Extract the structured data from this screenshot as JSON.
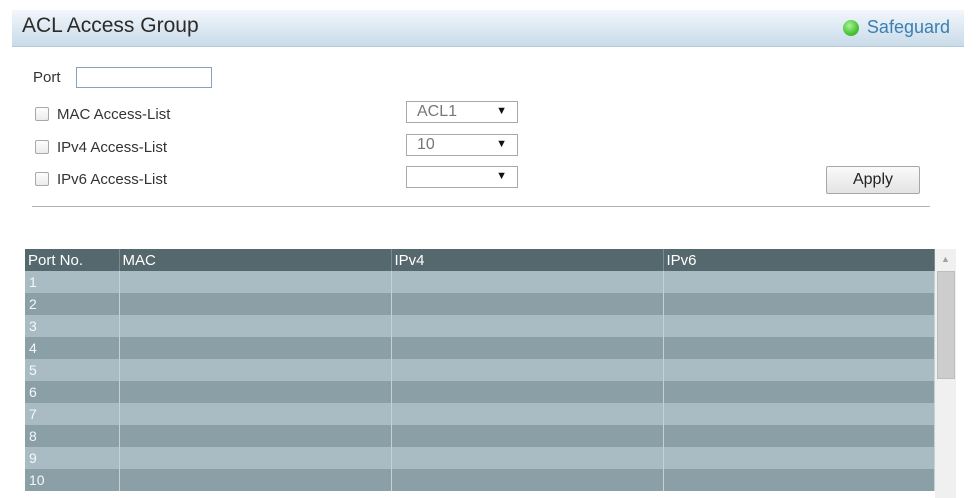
{
  "header": {
    "title": "ACL Access Group",
    "safeguard_label": "Safeguard",
    "status_color": "#4cc93a"
  },
  "form": {
    "port_label": "Port",
    "port_value": "",
    "rows": [
      {
        "label": "MAC Access-List",
        "checked": false,
        "select_value": "ACL1"
      },
      {
        "label": "IPv4 Access-List",
        "checked": false,
        "select_value": "10"
      },
      {
        "label": "IPv6 Access-List",
        "checked": false,
        "select_value": ""
      }
    ],
    "apply_label": "Apply"
  },
  "table": {
    "columns": [
      "Port No.",
      "MAC",
      "IPv4",
      "IPv6"
    ],
    "rows": [
      [
        "1",
        "",
        "",
        ""
      ],
      [
        "2",
        "",
        "",
        ""
      ],
      [
        "3",
        "",
        "",
        ""
      ],
      [
        "4",
        "",
        "",
        ""
      ],
      [
        "5",
        "",
        "",
        ""
      ],
      [
        "6",
        "",
        "",
        ""
      ],
      [
        "7",
        "",
        "",
        ""
      ],
      [
        "8",
        "",
        "",
        ""
      ],
      [
        "9",
        "",
        "",
        ""
      ],
      [
        "10",
        "",
        "",
        ""
      ]
    ]
  },
  "colors": {
    "header_row": "#55686d",
    "row_light": "#a9bcc3",
    "row_dark": "#8a9fa6",
    "brand_blue": "#3a7fb2"
  },
  "icons": {
    "status": "status-led-icon",
    "dropdown": "dropdown-arrow-icon",
    "scroll_up": "scroll-up-arrow-icon"
  }
}
